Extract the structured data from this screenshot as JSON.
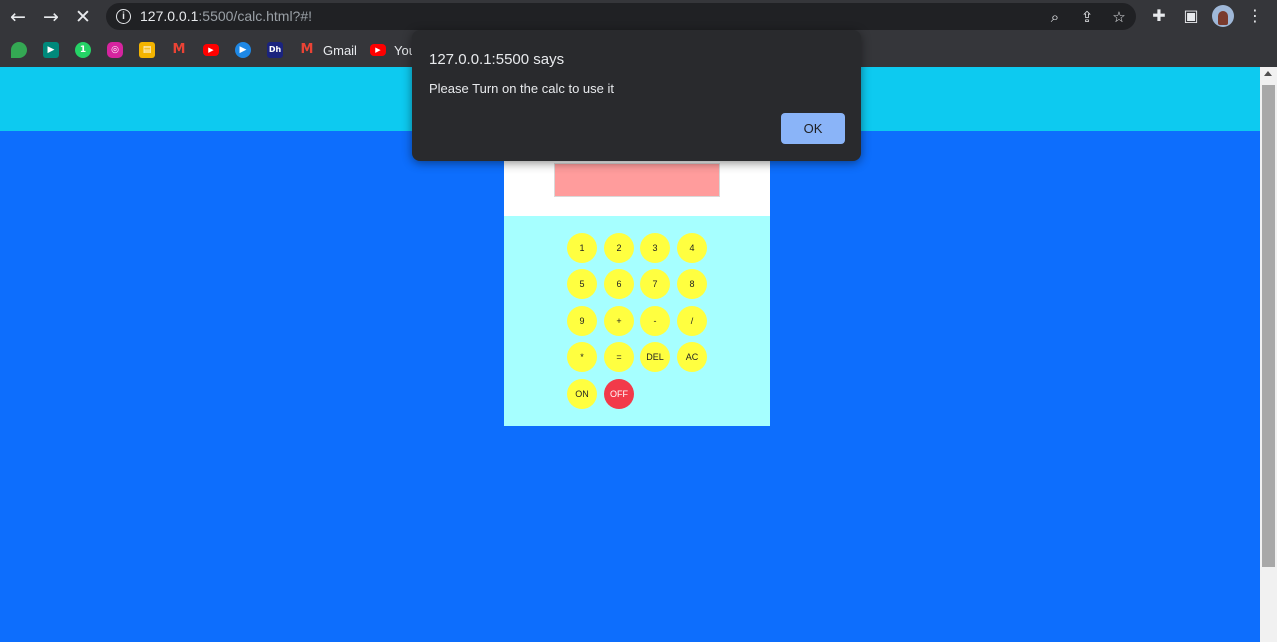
{
  "browser": {
    "url_host": "127.0.0.1",
    "url_rest": ":5500/calc.html?#!",
    "bookmarks": [
      {
        "label": "",
        "icon": "maps-icon",
        "color": "#34a853"
      },
      {
        "label": "",
        "icon": "meet-icon",
        "color": "#00897b"
      },
      {
        "label": "",
        "icon": "whatsapp-icon",
        "color": "#25d366"
      },
      {
        "label": "",
        "icon": "instagram-icon",
        "color": "#d6249f"
      },
      {
        "label": "",
        "icon": "classroom-icon",
        "color": "#f4b400"
      },
      {
        "label": "",
        "icon": "gmail-icon",
        "color": "#ea4335"
      },
      {
        "label": "",
        "icon": "youtube-icon",
        "color": "#ff0000"
      },
      {
        "label": "",
        "icon": "play-icon",
        "color": "#1e88e5"
      },
      {
        "label": "",
        "icon": "dh-icon",
        "color": "#1a237e"
      },
      {
        "label": "Gmail",
        "icon": "gmail-icon",
        "color": "#ea4335"
      },
      {
        "label": "You",
        "icon": "youtube-icon",
        "color": "#ff0000"
      }
    ]
  },
  "dialog": {
    "title": "127.0.0.1:5500 says",
    "message": "Please Turn on the calc to use it",
    "ok_label": "OK"
  },
  "calculator": {
    "display_value": "",
    "keys": [
      "1",
      "2",
      "3",
      "4",
      "5",
      "6",
      "7",
      "8",
      "9",
      "+",
      "-",
      "/",
      "*",
      "=",
      "DEL",
      "AC",
      "ON",
      "OFF"
    ]
  },
  "colors": {
    "page_bg": "#0d6efd",
    "header_bg": "#0dcaf0",
    "display_bg": "#ff9c9c",
    "pad_bg": "#a6ffff",
    "key_bg": "#ffff40",
    "off_key_bg": "#f23a4a",
    "dialog_bg": "#292a2d",
    "ok_button_bg": "#8ab4f8"
  }
}
